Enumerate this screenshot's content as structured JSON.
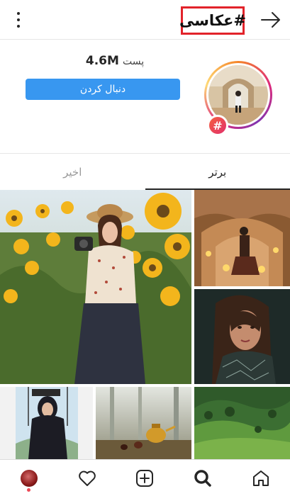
{
  "header": {
    "hashtag": "#عکاسی"
  },
  "profile": {
    "post_count": "4.6M",
    "post_label": "پست",
    "follow_label": "دنبال کردن",
    "badge_symbol": "#"
  },
  "tabs": {
    "top": "برتر",
    "recent": "اخیر"
  },
  "colors": {
    "follow_button": "#3897f0",
    "highlight_box": "#e2232a",
    "notification_dot": "#ed4956"
  },
  "grid": {
    "items": [
      {
        "name": "sunflower-field-photo"
      },
      {
        "name": "cave-candles-photo"
      },
      {
        "name": "portrait-dark-hair-photo"
      },
      {
        "name": "woman-on-swing-photo"
      },
      {
        "name": "teapot-forest-photo"
      },
      {
        "name": "green-hills-photo"
      }
    ]
  },
  "bottom_nav": {
    "items": [
      "profile",
      "activity",
      "new-post",
      "search",
      "home"
    ]
  }
}
